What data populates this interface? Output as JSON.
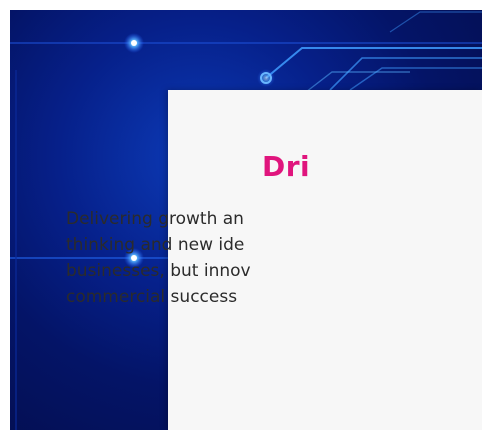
{
  "hero": {
    "background_icon": "circuit-board-pattern",
    "accent_color": "#4fa8ff"
  },
  "card": {
    "title": "Dri",
    "title_color": "#e0157d",
    "body_lines": [
      "Delivering growth an",
      "thinking and new ide",
      "businesses, but innov",
      "commercial success"
    ]
  }
}
